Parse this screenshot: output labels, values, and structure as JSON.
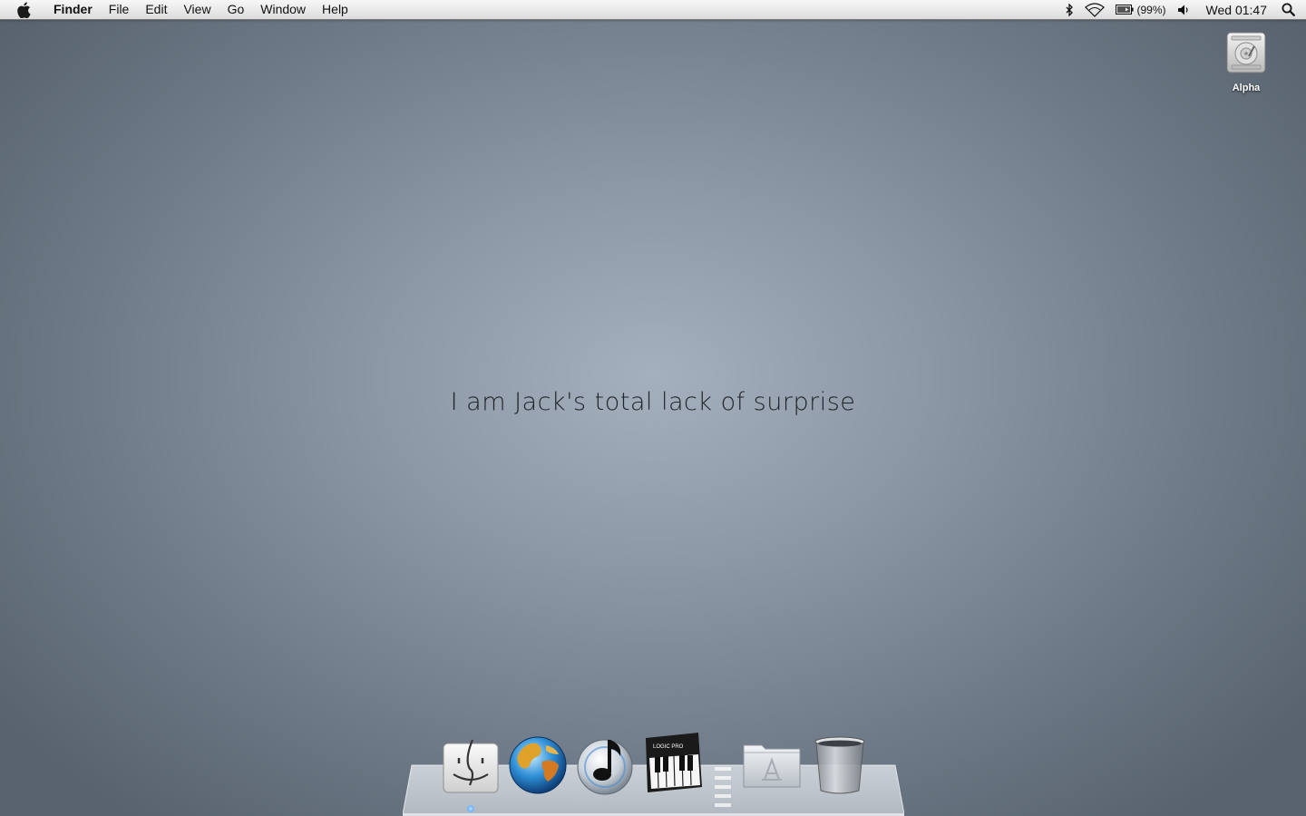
{
  "menubar": {
    "app_name": "Finder",
    "menus": [
      "File",
      "Edit",
      "View",
      "Go",
      "Window",
      "Help"
    ],
    "battery": "(99%)",
    "clock": "Wed 01:47"
  },
  "desktop": {
    "icons": [
      {
        "label": "Alpha",
        "icon": "hard-drive-icon"
      }
    ],
    "wallpaper_text": "I am Jack's total lack of surprise"
  },
  "dock": {
    "items": [
      "finder-icon",
      "globe-icon",
      "itunes-icon",
      "logic-pro-icon",
      "applications-folder-icon",
      "trash-icon"
    ],
    "logic_badge": "LOGIC PRO"
  },
  "colors": {
    "wallpaper_center": "#a4b0bd",
    "wallpaper_edge": "#58636f",
    "menubar": "#e8e8e8"
  }
}
